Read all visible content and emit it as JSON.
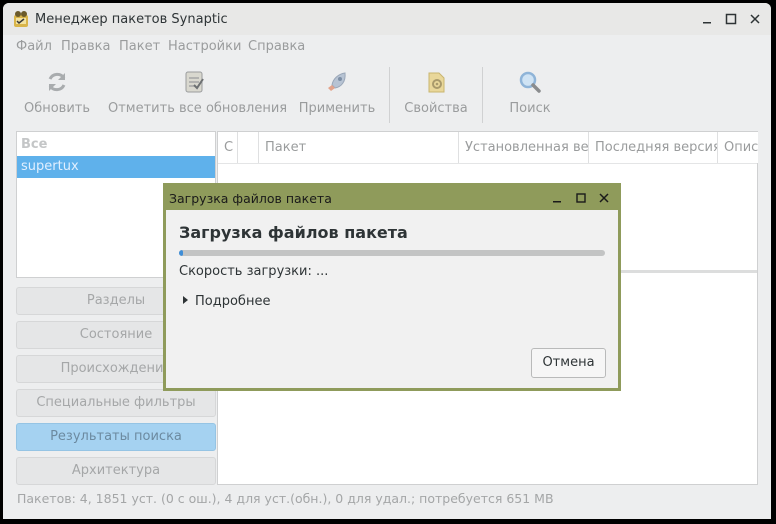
{
  "window": {
    "title": "Менеджер пакетов Synaptic"
  },
  "menu": [
    "Файл",
    "Правка",
    "Пакет",
    "Настройки",
    "Справка"
  ],
  "toolbar": {
    "refresh": "Обновить",
    "mark_all": "Отметить все обновления",
    "apply": "Применить",
    "properties": "Свойства",
    "search": "Поиск"
  },
  "filters": {
    "header": "Все",
    "selected": "supertux"
  },
  "sidebar_buttons": [
    "Разделы",
    "Состояние",
    "Происхождение",
    "Специальные фильтры",
    "Результаты поиска",
    "Архитектура"
  ],
  "columns": [
    "С",
    "",
    "Пакет",
    "Установленная версия",
    "Последняя версия",
    "Описание"
  ],
  "status": "Пакетов: 4, 1851 уст. (0 с ош.), 4 для уст.(обн.), 0 для удал.; потребуется 651 MB",
  "dialog": {
    "title": "Загрузка файлов пакета",
    "heading": "Загрузка файлов пакета",
    "speed": "Скорость загрузки: ...",
    "details": "Подробнее",
    "cancel": "Отмена",
    "progress": 0.01
  }
}
